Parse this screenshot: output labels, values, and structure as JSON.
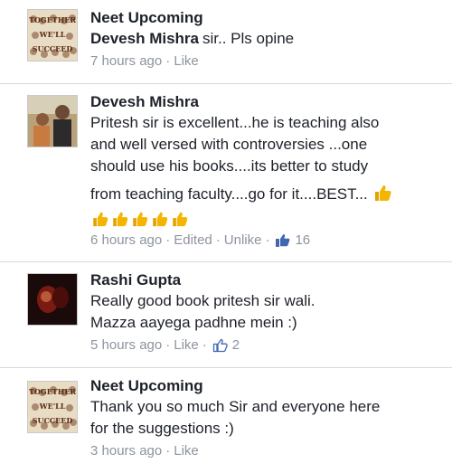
{
  "comments": [
    {
      "author": "Neet Upcoming",
      "avatar_text": [
        "TOGETHER",
        "WE'LL",
        "SUCCEED"
      ],
      "mention": "Devesh Mishra",
      "text": "sir..  Pls opine",
      "time": "7 hours ago",
      "action": "Like"
    },
    {
      "author": "Devesh Mishra",
      "text_lines": [
        "Pritesh sir is excellent...he is teaching also",
        "and well versed with controversies ...one",
        "should use his books....its better to study",
        "from teaching faculty....go for it....BEST..."
      ],
      "emoji_count": 5,
      "time": "6 hours ago",
      "edited": "Edited",
      "action": "Unlike",
      "likes": "16"
    },
    {
      "author": "Rashi Gupta",
      "text_lines": [
        "Really good book pritesh sir wali.",
        "Mazza aayega padhne mein :)"
      ],
      "time": "5 hours ago",
      "action": "Like",
      "likes": "2"
    },
    {
      "author": "Neet Upcoming",
      "avatar_text": [
        "TOGETHER",
        "WE'LL",
        "SUCCEED"
      ],
      "text_lines": [
        "Thank you so much Sir and everyone here",
        "for the suggestions :)"
      ],
      "time": "3 hours ago",
      "action": "Like"
    }
  ],
  "colors": {
    "meta": "#8d949e",
    "like_blue": "#4267b2",
    "divider": "#d5d9e0",
    "emoji_yellow": "#f4b400"
  },
  "icons": {
    "like": "thumbs-up-icon",
    "emoji": "thumbs-up-emoji"
  }
}
